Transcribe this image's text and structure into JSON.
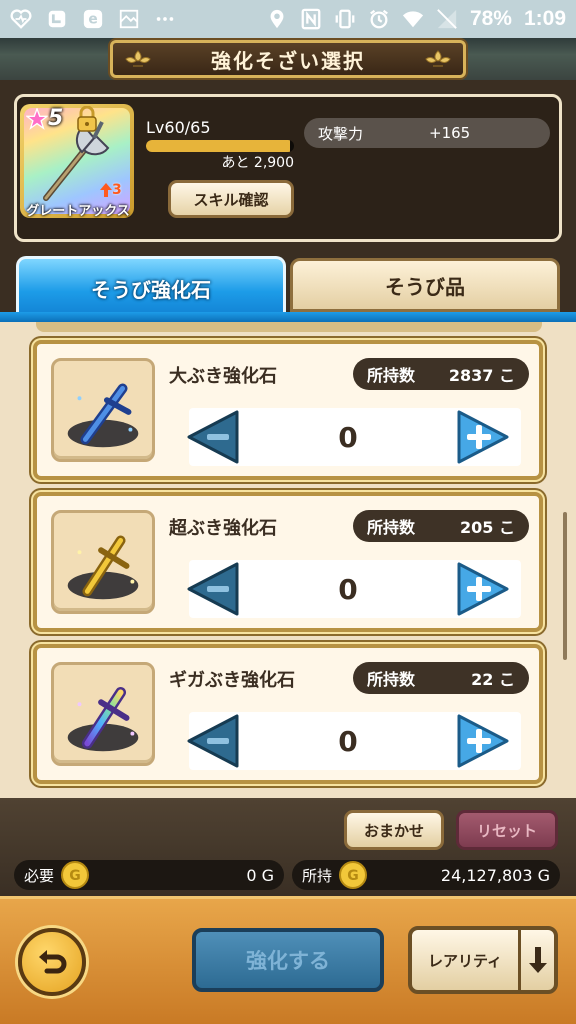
{
  "status_bar": {
    "battery": "78%",
    "time": "1:09",
    "icons": [
      "heart-monitor-icon",
      "shoe-icon",
      "e-icon",
      "image-icon",
      "more-icon",
      "location-icon",
      "nfc-icon",
      "vibrate-icon",
      "alarm-icon",
      "wifi-icon",
      "battery-icon"
    ]
  },
  "header": {
    "title": "強化そざい選択"
  },
  "equipment": {
    "rarity": "5",
    "name": "グレートアックス",
    "level": "Lv60/65",
    "exp_progress": 0.97,
    "exp_remaining": "あと 2,900",
    "plus": "3",
    "skill_button": "スキル確認",
    "stat_label": "攻撃力",
    "stat_value": "+165"
  },
  "tabs": [
    {
      "label": "そうび強化石",
      "active": true
    },
    {
      "label": "そうび品",
      "active": false
    }
  ],
  "items": [
    {
      "name": "大ぶき強化石",
      "owned_label": "所持数",
      "owned_count": "2837 こ",
      "quantity": "0",
      "color": "#2f6fd0"
    },
    {
      "name": "超ぶき強化石",
      "owned_label": "所持数",
      "owned_count": "205 こ",
      "quantity": "0",
      "color": "#e0b02a"
    },
    {
      "name": "ギガぶき強化石",
      "owned_label": "所持数",
      "owned_count": "22 こ",
      "quantity": "0",
      "color": "#b78aff"
    }
  ],
  "actions": {
    "omakase": "おまかせ",
    "reset": "リセット"
  },
  "cost": {
    "need_label": "必要",
    "need_amount": "0 G",
    "have_label": "所持",
    "have_amount": "24,127,803 G"
  },
  "footer": {
    "enhance": "強化する",
    "rarity": "レアリティ"
  }
}
